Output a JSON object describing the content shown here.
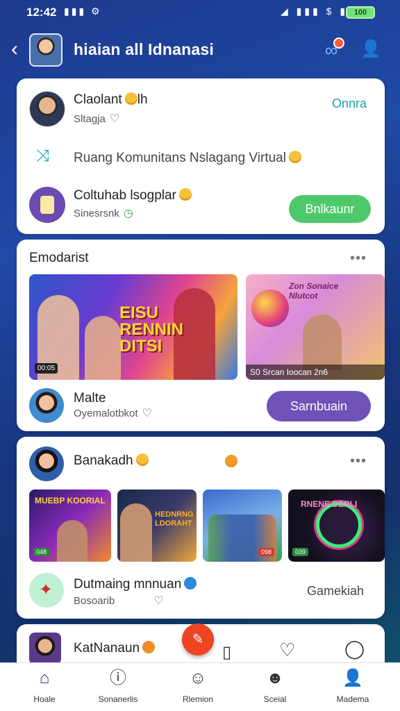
{
  "status": {
    "time": "12:42",
    "battery": "100"
  },
  "header": {
    "title": "hiaian all Idnanasi"
  },
  "card1": {
    "user_name": "Claolant",
    "user_suffix": "lh",
    "user_sub": "Sltagja",
    "online_label": "Onnra",
    "community_text": "Ruang Komunitans Nslagang Virtual",
    "group_name": "Coltuhab lsogplar",
    "group_sub": "Sinesrsnk",
    "join_button": "Bnlkaunr"
  },
  "card2": {
    "section_title": "Emodarist",
    "thumb1_text": "EISU RENNIN DITSI",
    "thumb1_badge": "00:05",
    "thumb2_text": "Zon Sonaice Nlutcot",
    "thumb2_caption": "S0 Srcan Ioocan 2n6",
    "user_name": "Malte",
    "user_sub": "Oyemalotbkot",
    "action_button": "Sarnbuain"
  },
  "card3": {
    "user_name": "Banakadh",
    "thumbs": [
      {
        "text": "MUEBP KOORIAL",
        "badge": "048"
      },
      {
        "text": "HEDNRNG LDORAHT",
        "badge": ""
      },
      {
        "text": "",
        "badge": "098"
      },
      {
        "text": "RNENE DERLI",
        "badge": "039"
      }
    ],
    "group_name": "Dutmaing mnnuan",
    "group_sub": "Bosoarib",
    "right_label": "Gamekiah"
  },
  "card4": {
    "user_name": "KatNanaun"
  },
  "nav": {
    "items": [
      {
        "label": "Hoale",
        "icon": "home-icon"
      },
      {
        "label": "Sonanerlis",
        "icon": "info-icon"
      },
      {
        "label": "Rlemion",
        "icon": "face-icon"
      },
      {
        "label": "Sceial",
        "icon": "smile-icon"
      },
      {
        "label": "Madema",
        "icon": "profile-icon"
      }
    ]
  },
  "colors": {
    "accent": "#7a4fc0",
    "online": "#1aa3b2",
    "join": "#4dc96b",
    "fab": "#ee4422"
  }
}
